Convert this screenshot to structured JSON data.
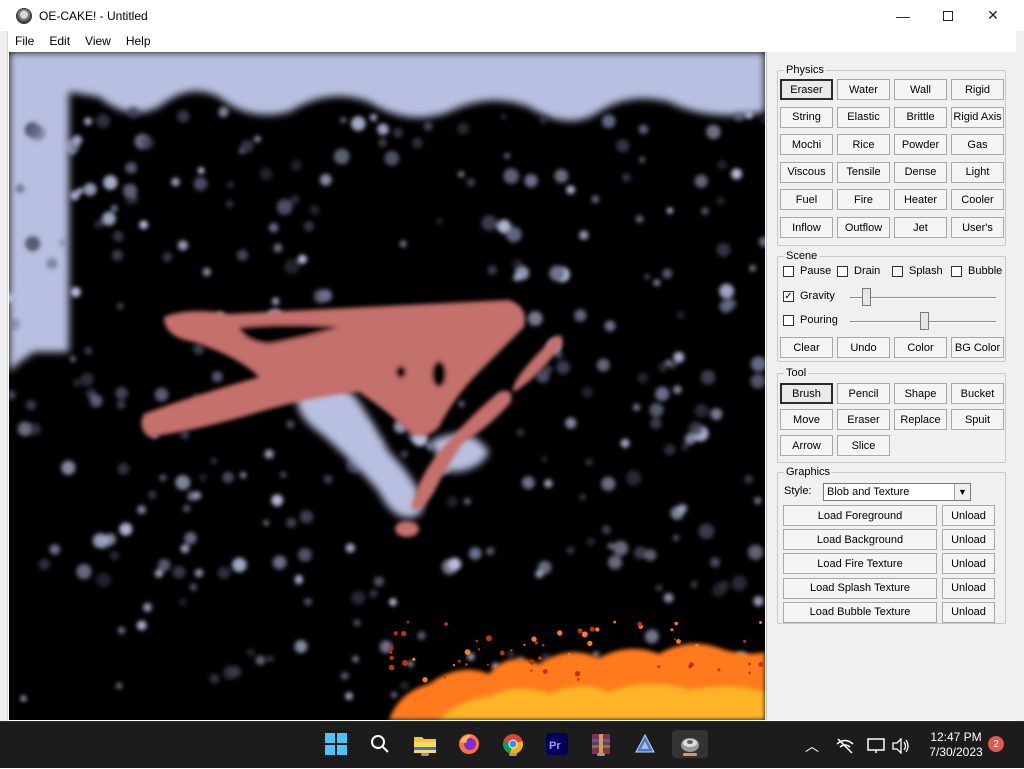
{
  "window": {
    "title": "OE-CAKE! - Untitled",
    "minimize_glyph": "—",
    "close_glyph": "✕"
  },
  "menu": [
    "File",
    "Edit",
    "View",
    "Help"
  ],
  "panel": {
    "physics": {
      "label": "Physics",
      "selected": "Eraser",
      "rows": [
        [
          "Eraser",
          "Water",
          "Wall",
          "Rigid"
        ],
        [
          "String",
          "Elastic",
          "Brittle",
          "Rigid Axis"
        ],
        [
          "Mochi",
          "Rice",
          "Powder",
          "Gas"
        ],
        [
          "Viscous",
          "Tensile",
          "Dense",
          "Light"
        ],
        [
          "Fuel",
          "Fire",
          "Heater",
          "Cooler"
        ],
        [
          "Inflow",
          "Outflow",
          "Jet",
          "User's"
        ]
      ]
    },
    "scene": {
      "label": "Scene",
      "checks": [
        {
          "label": "Pause",
          "checked": false
        },
        {
          "label": "Drain",
          "checked": false
        },
        {
          "label": "Splash",
          "checked": false
        },
        {
          "label": "Bubble",
          "checked": false
        }
      ],
      "gravity": {
        "label": "Gravity",
        "checked": true,
        "check_glyph": "✓",
        "level": 0.09
      },
      "pouring": {
        "label": "Pouring",
        "checked": false,
        "level": 0.51
      },
      "buttons": [
        "Clear",
        "Undo",
        "Color",
        "BG Color"
      ]
    },
    "tool": {
      "label": "Tool",
      "selected": "Brush",
      "rows": [
        [
          "Brush",
          "Pencil",
          "Shape",
          "Bucket"
        ],
        [
          "Move",
          "Eraser",
          "Replace",
          "Spuit"
        ],
        [
          "Arrow",
          "Slice"
        ]
      ]
    },
    "graphics": {
      "label": "Graphics",
      "style_label": "Style:",
      "style_value": "Blob and Texture",
      "dropdown_glyph": "▼",
      "loads": [
        {
          "load": "Load Foreground",
          "unload": "Unload"
        },
        {
          "load": "Load Background",
          "unload": "Unload"
        },
        {
          "load": "Load Fire Texture",
          "unload": "Unload"
        },
        {
          "load": "Load Splash Texture",
          "unload": "Unload"
        },
        {
          "load": "Load Bubble Texture",
          "unload": "Unload"
        }
      ]
    }
  },
  "colors": {
    "canvas_bg": "#000000",
    "particle": "#b9bfe0",
    "pink_solid": "#c4706c",
    "fire_hot": "#ff7a1a",
    "fire_core": "#ffb326"
  },
  "taskbar": {
    "icons": [
      "windows-start",
      "search",
      "file-explorer",
      "firefox",
      "chrome",
      "premiere-pro",
      "winrar",
      "app-triangle",
      "oe-cake"
    ],
    "tray": {
      "time": "12:47 PM",
      "date": "7/30/2023",
      "notification_count": "2",
      "chevron_glyph": "︿"
    }
  }
}
